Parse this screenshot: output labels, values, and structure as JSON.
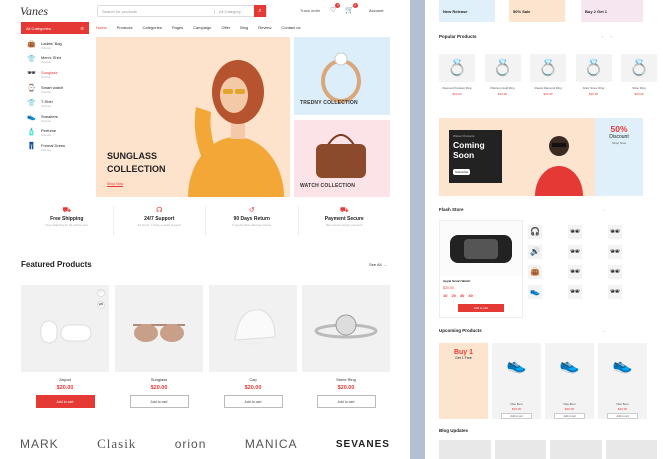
{
  "store": {
    "logo": "Vanes",
    "search_placeholder": "Search for products",
    "search_category": "All Category",
    "track_order": "Track order",
    "account": "Account",
    "cart_count_1": "0",
    "cart_count_2": "2"
  },
  "nav": {
    "all_categories": "All Categories",
    "links": [
      "Home",
      "Products",
      "Categories",
      "Pages",
      "Campaign",
      "Offer",
      "Blog",
      "Review",
      "Contact us"
    ]
  },
  "sidebar": {
    "items": [
      {
        "label": "Ladies' Bag",
        "sub": "3 Items",
        "icon": "bag-icon",
        "glyph": "👜"
      },
      {
        "label": "Men's Shirt",
        "sub": "3 Items",
        "icon": "shirt-icon",
        "glyph": "👕"
      },
      {
        "label": "Sunglass",
        "sub": "3 Items",
        "icon": "sunglass-icon",
        "glyph": "🕶"
      },
      {
        "label": "Smart watch",
        "sub": "3 Items",
        "icon": "watch-icon",
        "glyph": "⌚"
      },
      {
        "label": "T-Shirt",
        "sub": "3 Items",
        "icon": "tshirt-icon",
        "glyph": "👕"
      },
      {
        "label": "Sneakers",
        "sub": "3 Items",
        "icon": "sneaker-icon",
        "glyph": "👟"
      },
      {
        "label": "Perfume",
        "sub": "3 Items",
        "icon": "perfume-icon",
        "glyph": "🧴"
      },
      {
        "label": "Formal Dress",
        "sub": "3 Items",
        "icon": "dress-icon",
        "glyph": "👖"
      }
    ]
  },
  "hero": {
    "title": "SUNGLASS COLLECTION",
    "link": "Shop Now",
    "tile1": "TREDNY COLLECTION",
    "tile2": "WATCH COLLECTION"
  },
  "features": [
    {
      "title": "Free Shipping",
      "sub": "Free shipping for all orders over",
      "icon": "truck-icon",
      "glyph": "⛟"
    },
    {
      "title": "24/7 Support",
      "sub": "24 hours, 7 days a week support",
      "icon": "headset-icon",
      "glyph": "☊"
    },
    {
      "title": "90 Days Return",
      "sub": "If goods have damage issues",
      "icon": "return-icon",
      "glyph": "↺"
    },
    {
      "title": "Payment Secure",
      "sub": "We ensure secure payment",
      "icon": "lock-icon",
      "glyph": "⛟"
    }
  ],
  "featured": {
    "title": "Featured Products",
    "see_all": "See All",
    "products": [
      {
        "name": "Airpod",
        "price": "$20.00",
        "cart": "Add to cart"
      },
      {
        "name": "Sunglass",
        "price": "$20.00",
        "cart": "Add to cart"
      },
      {
        "name": "Cap",
        "price": "$20.00",
        "cart": "Add to cart"
      },
      {
        "name": "Stone Ring",
        "price": "$20.00",
        "cart": "Add to cart"
      }
    ]
  },
  "brands": [
    "MARK",
    "Clasik",
    "orion",
    "MANICA",
    "SEVANES"
  ],
  "right": {
    "banners": [
      {
        "title": "New Release"
      },
      {
        "title": "50% Sale"
      },
      {
        "title": "Buy 2 Get 1"
      }
    ],
    "popular_title": "Popular Products",
    "popular": [
      {
        "name": "Diamond Pendant Ring",
        "price": "$20.00"
      },
      {
        "name": "Platinum Gold Ring",
        "price": "$20.00"
      },
      {
        "name": "Classic Diamond Ring",
        "price": "$20.00"
      },
      {
        "name": "Ruby Stone Ring",
        "price": "$20.00"
      },
      {
        "name": "Silver Ring",
        "price": "$20.00"
      }
    ],
    "coming_tag": "Winter Products",
    "coming_title": "Coming Soon",
    "coming_btn": "Subscribe",
    "discount_pct": "50%",
    "discount_label": "Discount",
    "discount_sub": "Shop Now",
    "flash_title": "Flash Store",
    "flash_name": "Apple Smart Watch",
    "flash_price": "$20.00",
    "timer": [
      "10",
      "20",
      "30",
      "40"
    ],
    "flash_btn": "Add to cart",
    "upcoming_title": "Upcoming Products",
    "upcoming_promo_a": "Buy 1",
    "upcoming_promo_b": "Get 1 Free",
    "upcoming": [
      {
        "name": "Nike Boot",
        "price": "$20.00",
        "cart": "Add to cart"
      },
      {
        "name": "Nike Boot",
        "price": "$20.00",
        "cart": "Add to cart"
      },
      {
        "name": "Nike Boot",
        "price": "$20.00",
        "cart": "Add to cart"
      }
    ],
    "blog_title": "Blog Updates"
  },
  "colors": {
    "accent": "#e53935",
    "hero_bg": "#fde2cc",
    "tile1_bg": "#dbeefa",
    "tile2_bg": "#fce3e7"
  }
}
